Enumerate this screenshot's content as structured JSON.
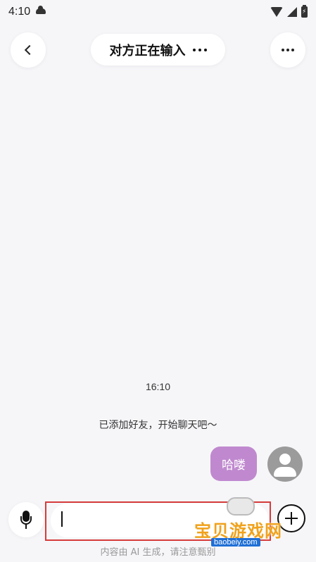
{
  "status_bar": {
    "time": "4:10",
    "battery_label": "⚡"
  },
  "header": {
    "title": "对方正在输入",
    "back_icon": "chevron-left-icon",
    "more_icon": "more-dots-icon"
  },
  "chat": {
    "timestamp": "16:10",
    "system_message": "已添加好友，开始聊天吧～",
    "messages": [
      {
        "sender": "me",
        "text": "哈喽"
      }
    ]
  },
  "input_bar": {
    "value": "",
    "placeholder": "",
    "mic_icon": "microphone-icon",
    "plus_icon": "plus-circle-icon"
  },
  "disclaimer": "内容由 AI 生成，请注意甄别",
  "watermark": {
    "text": "宝贝游戏网",
    "url": "baobeiy.com"
  },
  "colors": {
    "background": "#f6f6f9",
    "bubble": "#c089cf",
    "highlight_frame": "#d63b3b"
  }
}
